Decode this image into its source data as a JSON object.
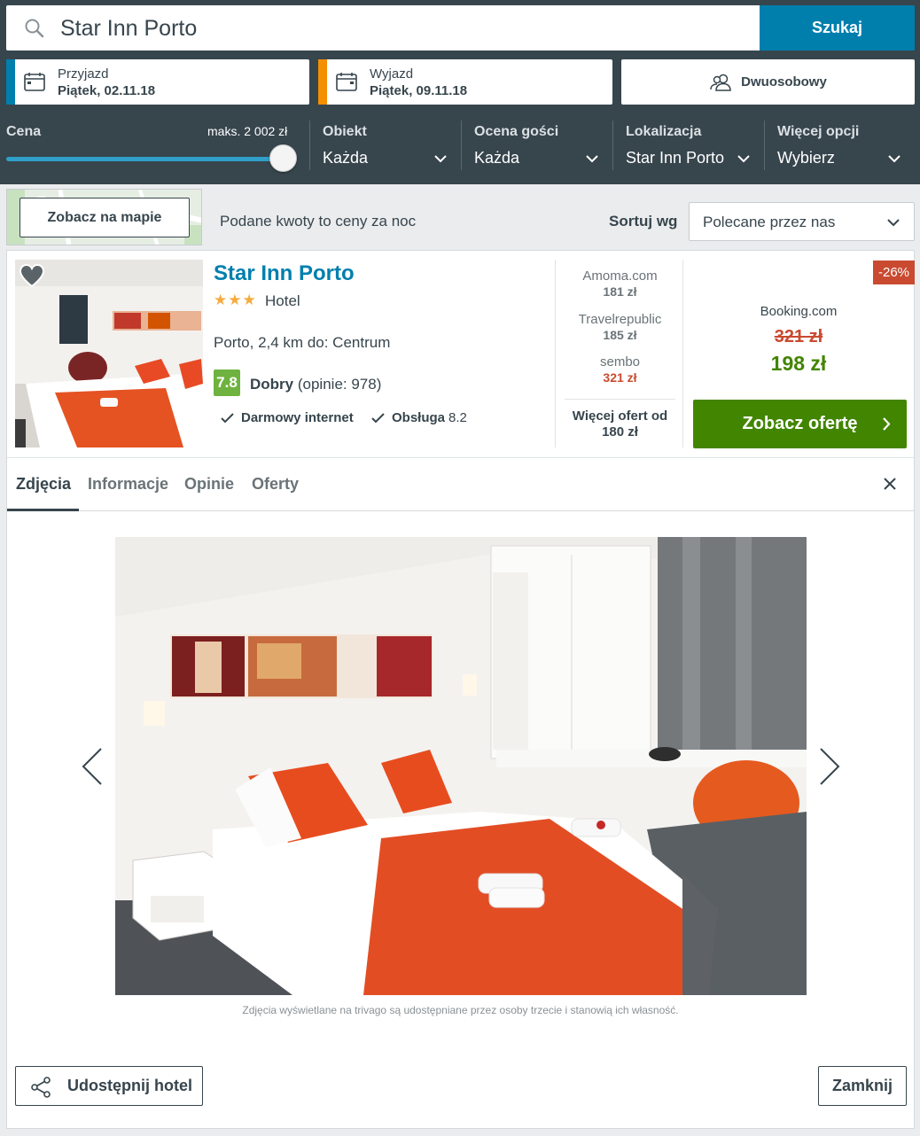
{
  "search": {
    "query": "Star Inn Porto",
    "button": "Szukaj"
  },
  "checkin": {
    "label": "Przyjazd",
    "value": "Piątek, 02.11.18",
    "accent": "#007fad"
  },
  "checkout": {
    "label": "Wyjazd",
    "value": "Piątek, 09.11.18",
    "accent": "#f48f00"
  },
  "room": {
    "label": "Dwuosobowy"
  },
  "filters": {
    "price": {
      "label": "Cena",
      "max": "maks. 2 002 zł",
      "level": 1.0
    },
    "property": {
      "label": "Obiekt",
      "value": "Każda"
    },
    "guest_rating": {
      "label": "Ocena gości",
      "value": "Każda"
    },
    "location": {
      "label": "Lokalizacja",
      "value": "Star Inn Porto"
    },
    "more": {
      "label": "Więcej opcji",
      "value": "Wybierz"
    }
  },
  "results_bar": {
    "map_button": "Zobacz na mapie",
    "price_note": "Podane kwoty to ceny za noc",
    "sort_label": "Sortuj wg",
    "sort_value": "Polecane przez nas"
  },
  "hotel": {
    "name": "Star Inn Porto",
    "stars": "★★★",
    "type": "Hotel",
    "location": "Porto, 2,4 km do: Centrum",
    "rating": "7.8",
    "rating_word": "Dobry",
    "reviews": "(opinie: 978)",
    "amenity_1": "Darmowy internet",
    "amenity_2": "Obsługa",
    "amenity_2_score": "8.2",
    "offers": [
      {
        "provider": "Amoma.com",
        "price": "181 zł"
      },
      {
        "provider": "Travelrepublic",
        "price": "185 zł"
      },
      {
        "provider": "sembo",
        "price": "321 zł"
      }
    ],
    "more_offers_line1": "Więcej ofert od",
    "more_offers_line2": "180 zł",
    "discount": "-26%",
    "best_provider": "Booking.com",
    "old_price": "321 zł",
    "new_price": "198 zł",
    "deal_button": "Zobacz ofertę"
  },
  "tabs": [
    "Zdjęcia",
    "Informacje",
    "Opinie",
    "Oferty"
  ],
  "gallery": {
    "caption": "Zdjęcia wyświetlane na trivago są udostępniane przez osoby trzecie i stanowią ich własność."
  },
  "footer": {
    "share": "Udostępnij hotel",
    "close": "Zamknij"
  },
  "colors": {
    "header": "#37454d",
    "brand_blue": "#007fad",
    "deal_green": "#428500",
    "rating_green": "#6eb23f",
    "discount_red": "#c94a30"
  }
}
